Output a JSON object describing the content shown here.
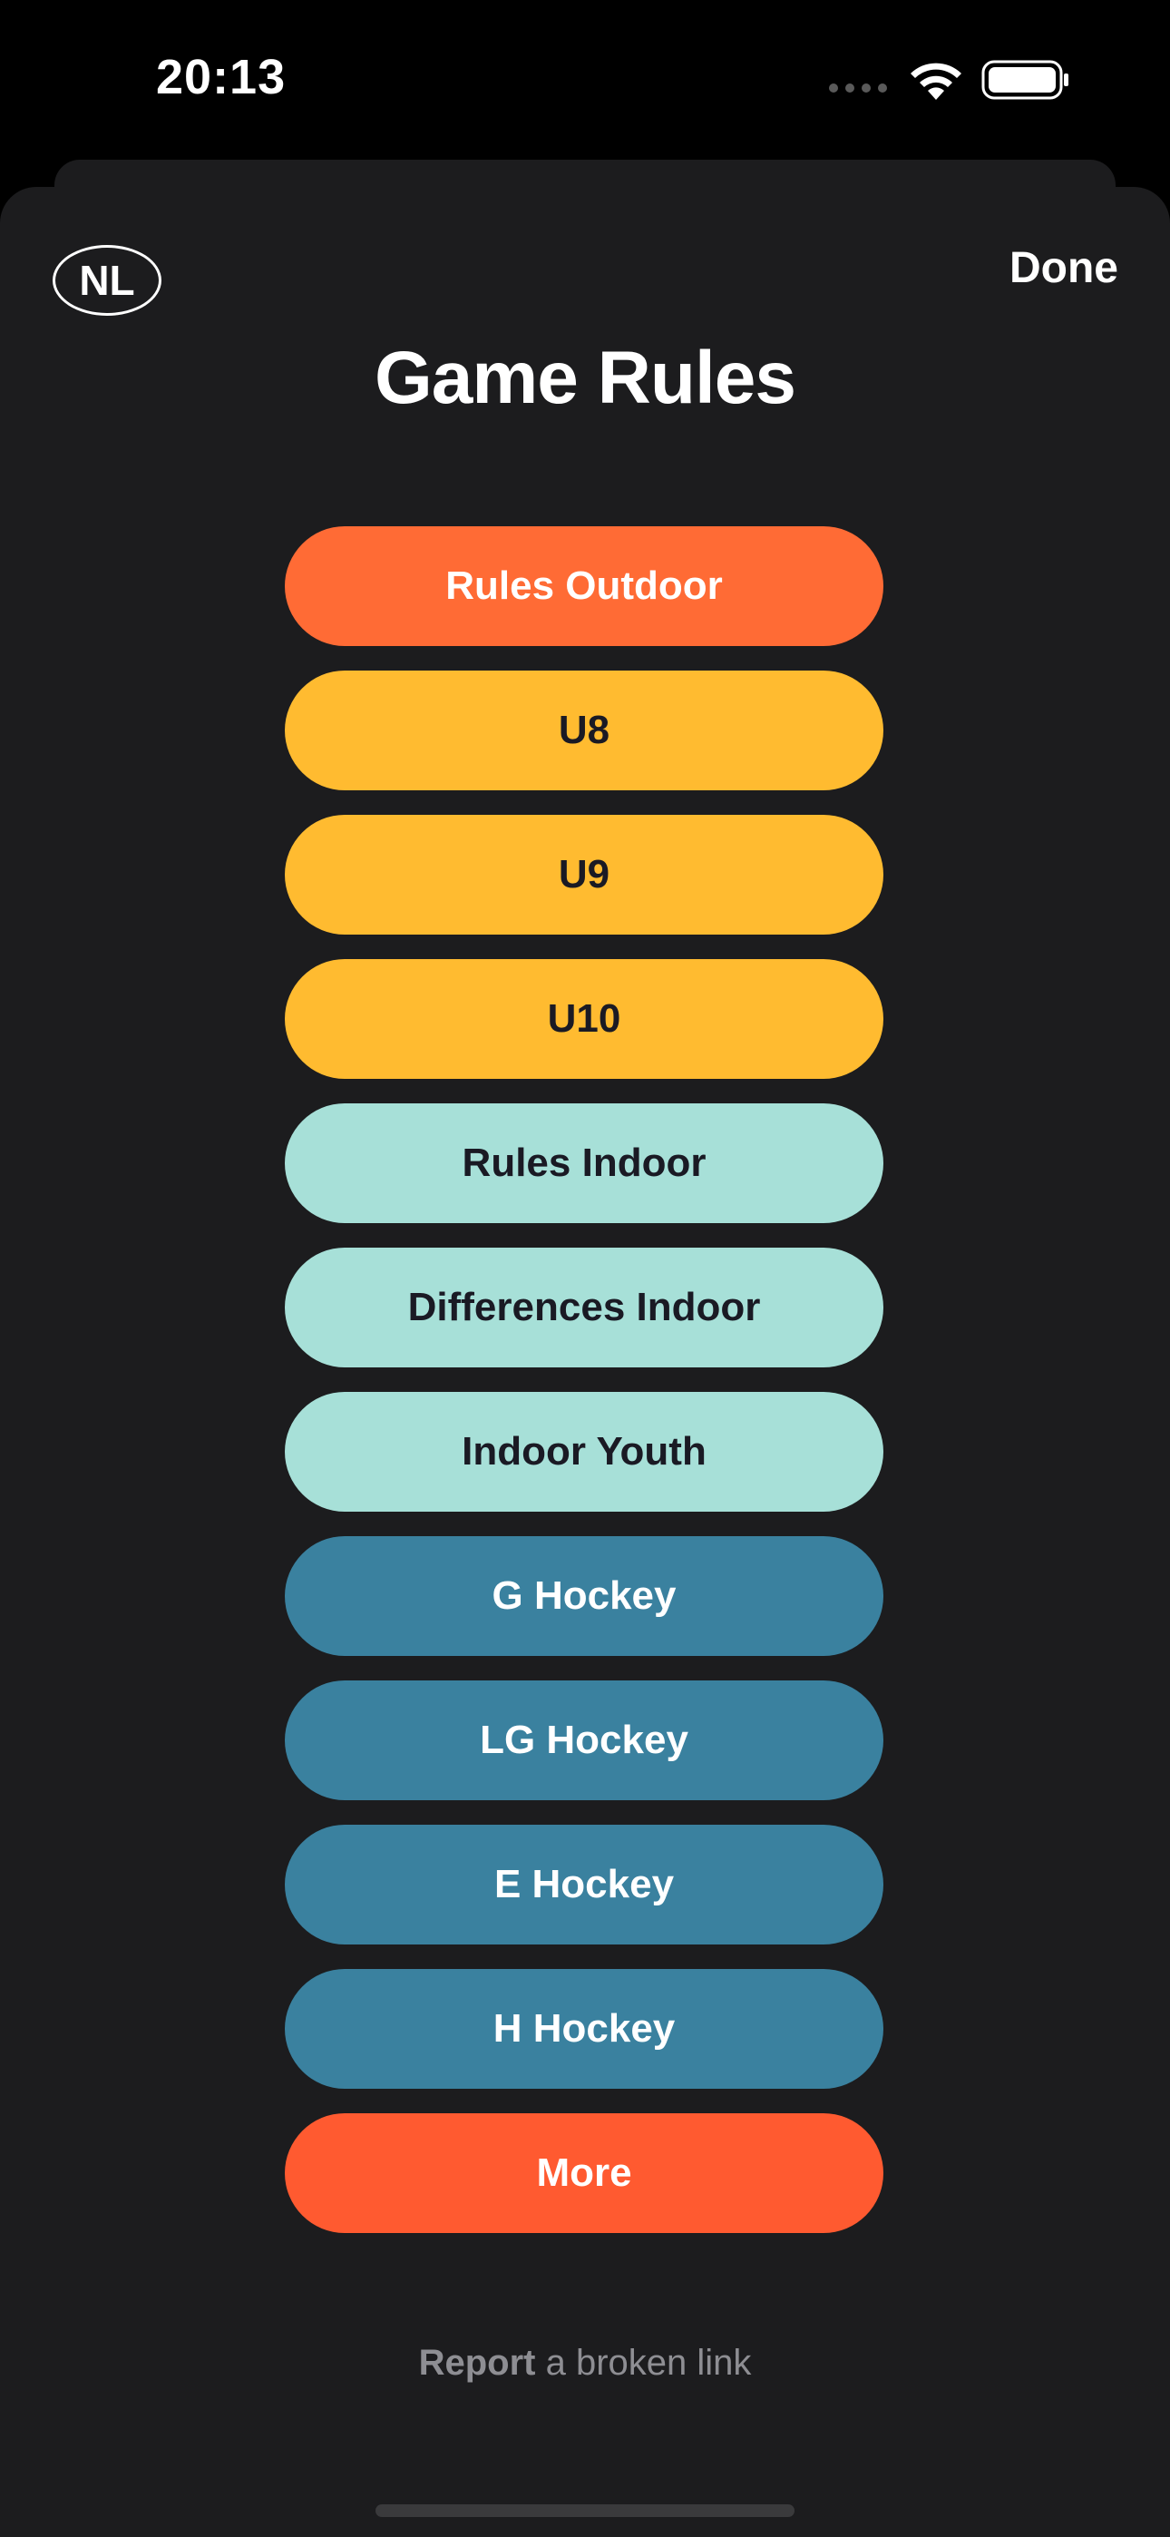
{
  "status_bar": {
    "time": "20:13"
  },
  "header": {
    "language_badge": "NL",
    "done_label": "Done",
    "title": "Game Rules"
  },
  "rules": [
    {
      "label": "Rules Outdoor",
      "color": "#ff6b35"
    },
    {
      "label": "U8",
      "color": "#ffbb30"
    },
    {
      "label": "U9",
      "color": "#ffbb30"
    },
    {
      "label": "U10",
      "color": "#ffbb30"
    },
    {
      "label": "Rules Indoor",
      "color": "#a7e0d8"
    },
    {
      "label": "Differences Indoor",
      "color": "#a7e0d8"
    },
    {
      "label": "Indoor Youth",
      "color": "#a7e0d8"
    },
    {
      "label": "G Hockey",
      "color": "#3a819f"
    },
    {
      "label": "LG Hockey",
      "color": "#3a819f"
    },
    {
      "label": "E Hockey",
      "color": "#3a819f"
    },
    {
      "label": "H Hockey",
      "color": "#3a819f"
    },
    {
      "label": "More",
      "color": "#ff5a30"
    }
  ],
  "footer": {
    "report_bold": "Report",
    "report_rest": " a broken link"
  },
  "colors": {
    "background": "#1c1c1e",
    "accent_orange": "#ff6b35",
    "youth_yellow": "#ffbb30",
    "indoor_mint": "#a7e0d8",
    "hockey_blue": "#3a819f"
  },
  "icons": {
    "wifi": "wifi-icon",
    "battery": "battery-icon",
    "signal": "cellular-signal-icon"
  }
}
